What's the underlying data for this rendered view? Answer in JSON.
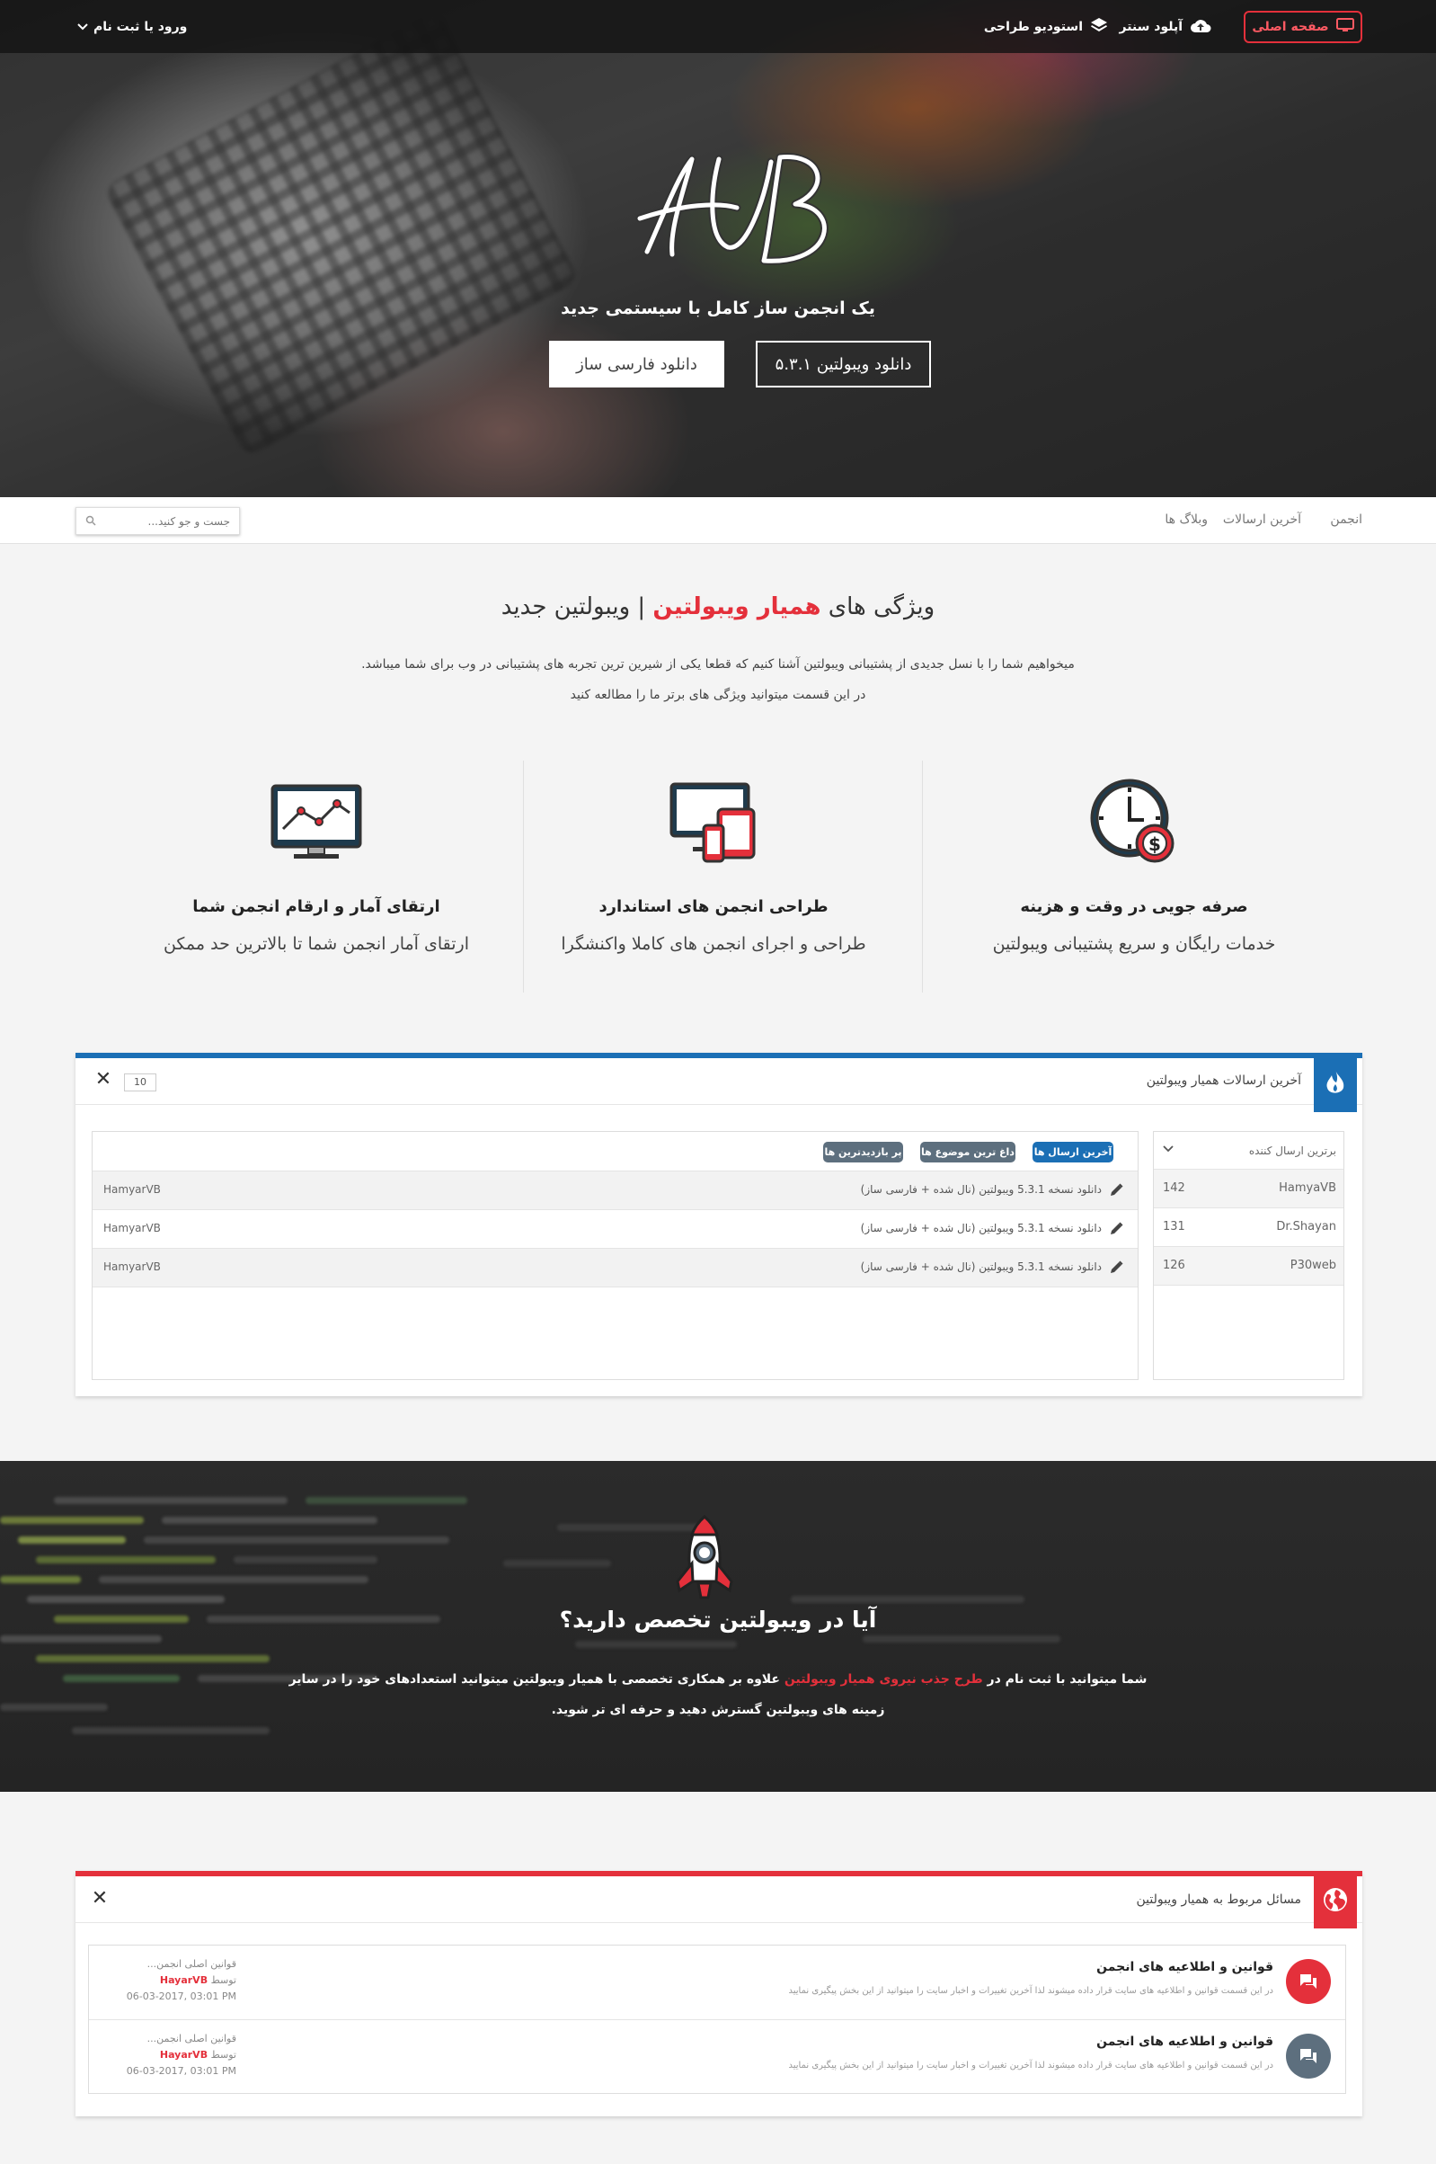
{
  "topbar": {
    "home_label": "صفحه اصلی",
    "upload_label": "آپلود سنتر",
    "studio_label": "استودیو طراحی",
    "login_label": "ورود یا ثبت نام"
  },
  "hero": {
    "tagline": "یک انجمن ساز کامل با سیستمی جدید",
    "btn_download_fa": "دانلود فارسی ساز",
    "btn_download_vb": "دانلود ویبولتین ۵.۳.۱"
  },
  "nav": {
    "items": [
      "انجمن",
      "آخرین ارسالات",
      "وبلاگ ها"
    ],
    "search_placeholder": "جست و جو کنید..."
  },
  "features": {
    "title_pre": "ویژگی های ",
    "title_red": "همیار ویبولتین",
    "title_post": " | ویبولتین جدید",
    "desc_line1": "میخواهیم شما را با نسل جدیدی از پشتیبانی ویبولتین آشنا کنیم که قطعا یکی از شیرین ترین تجربه های پشتیبانی در وب برای شما میباشد.",
    "desc_line2": "در این قسمت میتوانید ویژگی های برتر ما را مطالعه کنید",
    "items": [
      {
        "icon": "clock-dollar-icon",
        "title": "صرفه جویی در وقت و هزینه",
        "desc": "خدمات رایگان و سریع پشتیبانی ویبولتین"
      },
      {
        "icon": "devices-icon",
        "title": "طراحی انجمن های استاندارد",
        "desc": "طراحی و اجرای انجمن های کاملا واکنشگرا"
      },
      {
        "icon": "monitor-chart-icon",
        "title": "ارتقای آمار و ارقام انجمن شما",
        "desc": "ارتقای آمار انجمن شما تا بالاترین حد ممکن"
      }
    ]
  },
  "latest_widget": {
    "title": "آخرین ارسالات همیار ویبولتین",
    "count": "10",
    "top_posters_label": "برترین ارسال کننده",
    "top_posters": [
      {
        "name": "HamyaVB",
        "count": "142"
      },
      {
        "name": "Dr.Shayan",
        "count": "131"
      },
      {
        "name": "P30web",
        "count": "126"
      }
    ],
    "tabs": [
      "آخرین ارسال ها",
      "داغ ترین موضوع ها",
      "پر بازدیدترین ها"
    ],
    "posts": [
      {
        "title": "دانلود نسخه 5.3.1 ویبولتین (نال شده + فارسی ساز)",
        "user": "HamyarVB"
      },
      {
        "title": "دانلود نسخه 5.3.1 ویبولتین (نال شده + فارسی ساز)",
        "user": "HamyarVB"
      },
      {
        "title": "دانلود نسخه 5.3.1 ویبولتین (نال شده + فارسی ساز)",
        "user": "HamyarVB"
      }
    ],
    "colors": {
      "accent": "#1b6fb5"
    }
  },
  "expert_band": {
    "title": "آیا در ویبولتین تخصص دارید؟",
    "line1_pre": "شما میتوانید با ثبت نام در ",
    "line1_red": "طرح جذب نیروی همیار ویبولتین",
    "line1_post": " علاوه بر همکاری تخصصی با همیار ویبولتین میتوانید استعدادهای خود را در سایر",
    "line2": "زمینه های ویبولتین گسترش دهید و حرفه ای تر شوید."
  },
  "forum_widget": {
    "title": "مسائل مربوط به همیار ویبولتین",
    "forums": [
      {
        "title": "قوانین و اطلاعیه های انجمن",
        "desc": "در این قسمت قوانین و اطلاعیه های سایت قرار داده میشوند لذا آخرین تغییرات و اخبار سایت را میتوانید از این بخش پیگیری نمایید",
        "last_title": "قوانین اصلی انجمن...",
        "by": "توسط",
        "user": "HayarVB",
        "date": "06-03-2017, 03:01 PM",
        "icon_color": "#e4303b"
      },
      {
        "title": "قوانین و اطلاعیه های انجمن",
        "desc": "در این قسمت قوانین و اطلاعیه های سایت قرار داده میشوند لذا آخرین تغییرات و اخبار سایت را میتوانید از این بخش پیگیری نمایید",
        "last_title": "قوانین اصلی انجمن...",
        "by": "توسط",
        "user": "HayarVB",
        "date": "06-03-2017, 03:01 PM",
        "icon_color": "#5d6f7e"
      }
    ],
    "colors": {
      "accent": "#e4303b"
    }
  }
}
